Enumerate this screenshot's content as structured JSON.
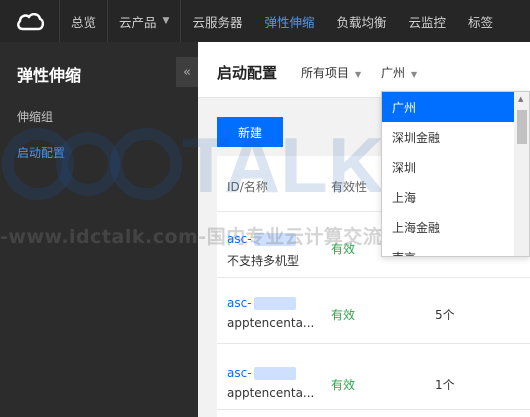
{
  "topbar": {
    "nav": [
      {
        "label": "总览"
      },
      {
        "label": "云产品",
        "has_caret": true
      },
      {
        "label": "云服务器"
      },
      {
        "label": "弹性伸缩",
        "active": true
      },
      {
        "label": "负载均衡"
      },
      {
        "label": "云监控"
      },
      {
        "label": "标签"
      }
    ]
  },
  "sidebar": {
    "title": "弹性伸缩",
    "collapse_icon": "«",
    "items": [
      {
        "label": "伸缩组"
      },
      {
        "label": "启动配置",
        "active": true
      }
    ]
  },
  "header": {
    "title": "启动配置",
    "project": "所有项目",
    "region": "广州"
  },
  "toolbar": {
    "new_label": "新建"
  },
  "table": {
    "columns": [
      "ID/名称",
      "有效性"
    ],
    "rows": [
      {
        "id": "asc-",
        "name": "不支持多机型",
        "validity": "有效",
        "count": ""
      },
      {
        "id": "asc-",
        "name": "apptencenta...",
        "validity": "有效",
        "count": "5个"
      },
      {
        "id": "asc-",
        "name": "apptencenta...",
        "validity": "有效",
        "count": "1个"
      }
    ]
  },
  "region_dropdown": {
    "options": [
      "广州",
      "深圳金融",
      "深圳",
      "上海",
      "上海金融",
      "南京"
    ],
    "selected": "广州"
  },
  "watermark": {
    "brand": "TALK 云说",
    "text": "-www.idctalk.com-国内专业云计算交流服务平台-"
  },
  "colors": {
    "accent": "#006eff",
    "valid": "#2ea44f",
    "topbar": "#262626",
    "sidebar": "#2c2c2c"
  }
}
